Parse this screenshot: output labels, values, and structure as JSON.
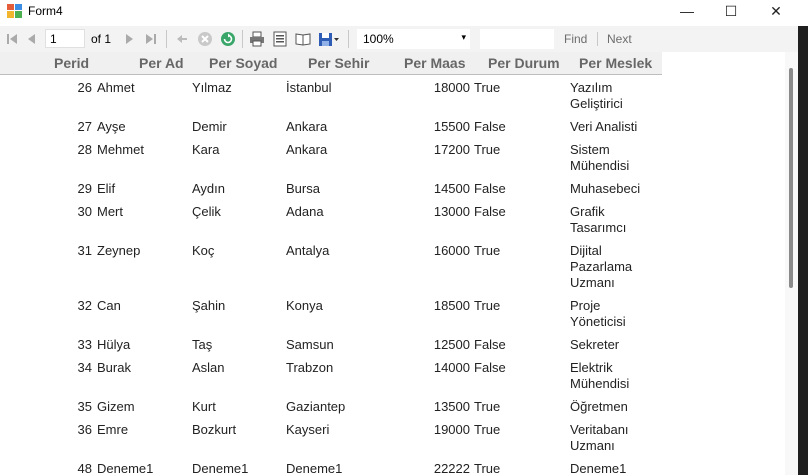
{
  "window": {
    "title": "Form4",
    "minimize": "—",
    "maximize": "☐",
    "close": "✕"
  },
  "toolbar": {
    "page_value": "1",
    "of_label": "of 1",
    "zoom": "100%",
    "zoom_arrow": "▾",
    "find_placeholder": "",
    "find_label": "Find",
    "next_label": "Next"
  },
  "report": {
    "columns": [
      "Perid",
      "Per Ad",
      "Per Soyad",
      "Per Sehir",
      "Per Maas",
      "Per Durum",
      "Per Meslek"
    ],
    "rows": [
      {
        "id": "26",
        "ad": "Ahmet",
        "soyad": "Yılmaz",
        "sehir": "İstanbul",
        "maas": "18000",
        "durum": "True",
        "meslek": [
          "Yazılım",
          "Geliştirici"
        ]
      },
      {
        "id": "27",
        "ad": "Ayşe",
        "soyad": "Demir",
        "sehir": "Ankara",
        "maas": "15500",
        "durum": "False",
        "meslek": [
          "Veri Analisti"
        ]
      },
      {
        "id": "28",
        "ad": "Mehmet",
        "soyad": "Kara",
        "sehir": "Ankara",
        "maas": "17200",
        "durum": "True",
        "meslek": [
          "Sistem",
          "Mühendisi"
        ]
      },
      {
        "id": "29",
        "ad": "Elif",
        "soyad": "Aydın",
        "sehir": "Bursa",
        "maas": "14500",
        "durum": "False",
        "meslek": [
          "Muhasebeci"
        ]
      },
      {
        "id": "30",
        "ad": "Mert",
        "soyad": "Çelik",
        "sehir": "Adana",
        "maas": "13000",
        "durum": "False",
        "meslek": [
          "Grafik",
          "Tasarımcı"
        ]
      },
      {
        "id": "31",
        "ad": "Zeynep",
        "soyad": "Koç",
        "sehir": "Antalya",
        "maas": "16000",
        "durum": "True",
        "meslek": [
          "Dijital",
          "Pazarlama",
          "Uzmanı"
        ]
      },
      {
        "id": "32",
        "ad": "Can",
        "soyad": "Şahin",
        "sehir": "Konya",
        "maas": "18500",
        "durum": "True",
        "meslek": [
          "Proje",
          "Yöneticisi"
        ]
      },
      {
        "id": "33",
        "ad": "Hülya",
        "soyad": "Taş",
        "sehir": "Samsun",
        "maas": "12500",
        "durum": "False",
        "meslek": [
          "Sekreter"
        ]
      },
      {
        "id": "34",
        "ad": "Burak",
        "soyad": "Aslan",
        "sehir": "Trabzon",
        "maas": "14000",
        "durum": "False",
        "meslek": [
          "Elektrik",
          "Mühendisi"
        ]
      },
      {
        "id": "35",
        "ad": "Gizem",
        "soyad": "Kurt",
        "sehir": "Gaziantep",
        "maas": "13500",
        "durum": "True",
        "meslek": [
          "Öğretmen"
        ]
      },
      {
        "id": "36",
        "ad": "Emre",
        "soyad": "Bozkurt",
        "sehir": "Kayseri",
        "maas": "19000",
        "durum": "True",
        "meslek": [
          "Veritabanı",
          "Uzmanı"
        ]
      },
      {
        "id": "48",
        "ad": "Deneme1",
        "soyad": "Deneme1",
        "sehir": "Deneme1",
        "maas": "22222",
        "durum": "True",
        "meslek": [
          "Deneme1"
        ]
      }
    ]
  },
  "icons": {
    "first": "first-page-icon",
    "prev": "previous-page-icon",
    "next": "next-page-icon",
    "last": "last-page-icon",
    "back": "back-to-parent-icon",
    "stop": "stop-icon",
    "refresh": "refresh-icon",
    "print": "print-icon",
    "print_layout": "print-layout-icon",
    "page_setup": "page-setup-icon",
    "export": "export-icon"
  }
}
